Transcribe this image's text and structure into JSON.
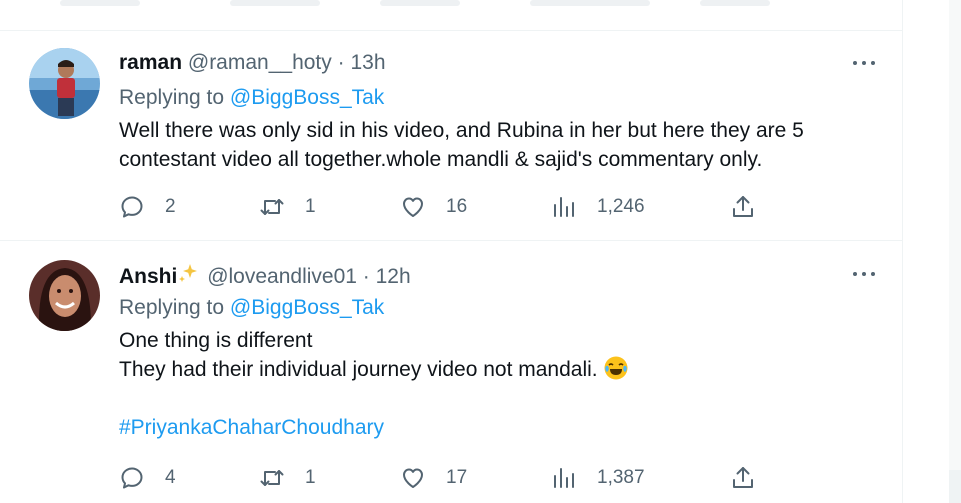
{
  "tweets": [
    {
      "name": "raman",
      "handle": "@raman__hoty",
      "separator": "·",
      "time": "13h",
      "replying_prefix": "Replying to",
      "replying_to": "@BiggBoss_Tak",
      "body_lines": [
        "Well there was only sid in his video, and Rubina in her but here they are 5",
        "contestant video all together.whole mandli & sajid's commentary only."
      ],
      "replies": "2",
      "retweets": "1",
      "likes": "16",
      "views": "1,246",
      "avatar": "person-icon"
    },
    {
      "name": "Anshi",
      "name_emoji": "sparkles-icon",
      "handle": "@loveandlive01",
      "separator": "·",
      "time": "12h",
      "replying_prefix": "Replying to",
      "replying_to": "@BiggBoss_Tak",
      "body_lines": [
        "One thing is different",
        "They had their individual journey video not mandali."
      ],
      "body_emoji": "laughing-tears-emoji",
      "hashtag": "#PriyankaChaharChoudhary",
      "replies": "4",
      "retweets": "1",
      "likes": "17",
      "views": "1,387",
      "avatar": "person-icon"
    }
  ],
  "colors": {
    "text": "#0f1419",
    "secondary": "#536471",
    "link": "#1d9bf0",
    "border": "#eff3f4"
  }
}
